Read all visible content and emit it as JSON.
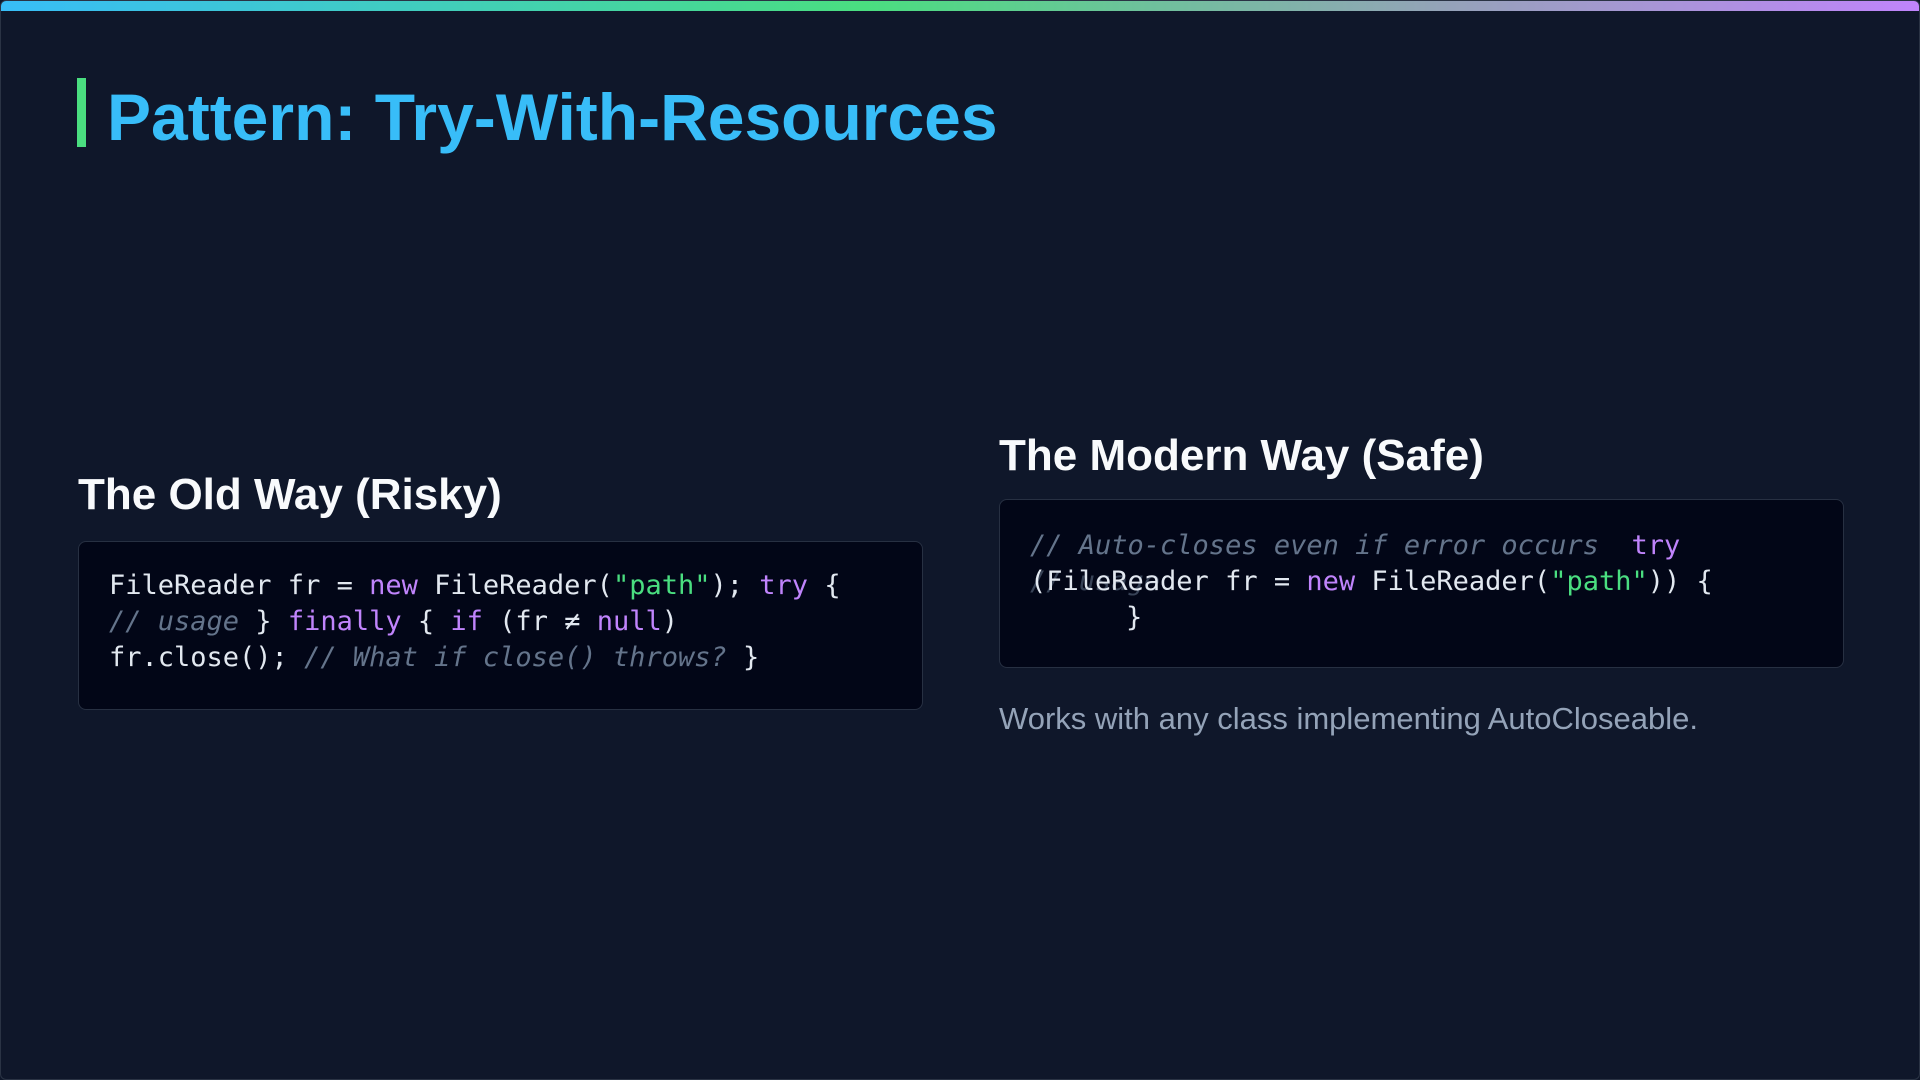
{
  "slide": {
    "title": "Pattern: Try-With-Resources",
    "colors": {
      "background": "#0f172a",
      "title": "#38bdf8",
      "accent_green": "#4ade80",
      "keyword": "#c084fc",
      "string": "#4ade80",
      "comment": "#64748b",
      "code_background": "#020617"
    }
  },
  "old_way": {
    "heading": "The Old Way (Risky)",
    "code": {
      "line1": {
        "t1": "FileReader fr = ",
        "t2": "new",
        "t3": " FileReader(",
        "t4": "\"path\"",
        "t5": "); ",
        "t6": "try",
        "t7": " {"
      },
      "line2": {
        "t1": "// usage",
        "t2": " } ",
        "t3": "finally",
        "t4": " { ",
        "t5": "if",
        "t6": " (fr ≠ ",
        "t7": "null",
        "t8": ")"
      },
      "line3": {
        "t1": "fr.close(); ",
        "t2": "// What if close() throws?",
        "t3": " }"
      }
    }
  },
  "modern_way": {
    "heading": "The Modern Way (Safe)",
    "code": {
      "line1": {
        "t1": "// Auto-closes even if error occurs",
        "t2": "  try"
      },
      "line2": {
        "t1": "(FileReader fr = ",
        "t2": "new",
        "t3": " FileReader(",
        "t4": "\"path\"",
        "t5": ")) {"
      },
      "ghost": "// usage",
      "line3": {
        "t1": "}"
      }
    },
    "note": "Works with any class implementing AutoCloseable."
  }
}
